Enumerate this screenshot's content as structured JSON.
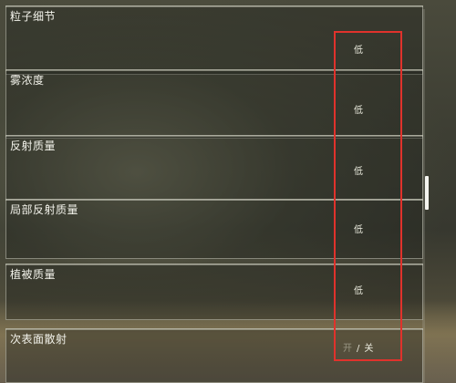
{
  "settings": [
    {
      "label": "粒子细节",
      "value": "低"
    },
    {
      "label": "雾浓度",
      "value": "低"
    },
    {
      "label": "反射质量",
      "value": "低"
    },
    {
      "label": "局部反射质量",
      "value": "低"
    },
    {
      "label": "植被质量",
      "value": "低"
    },
    {
      "label": "次表面散射",
      "toggle_on": "开",
      "toggle_sep": "/",
      "toggle_off": "关"
    }
  ],
  "colors": {
    "highlight": "#e0322c",
    "text": "#f2f2ea"
  }
}
